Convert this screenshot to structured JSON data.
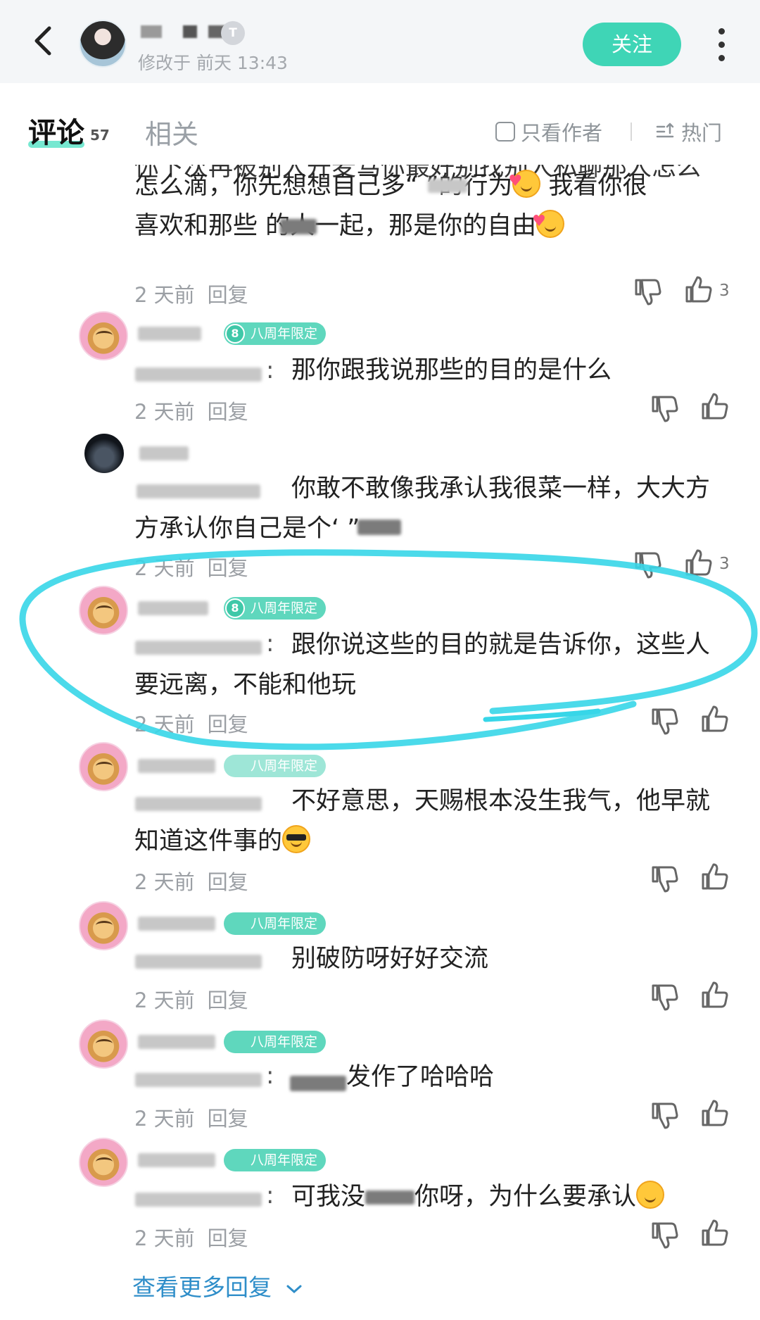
{
  "header": {
    "modified": "修改于 前天 13:43",
    "level_badge": "T",
    "follow_label": "关注"
  },
  "tabs": {
    "comments_label": "评论",
    "comments_count": "57",
    "related_label": "相关",
    "author_only_label": "只看作者",
    "sort_label": "热门"
  },
  "comments": [
    {
      "cut_line": "你下次再被别人开麦骂你最好别找别人私聊那人怎么",
      "lines": [
        "怎么滴，你先想想自己多“      ”的行为",
        "   我看你很",
        "喜欢和那些        的人一起，那是你的自由"
      ],
      "time": "2 天前",
      "reply": "回复",
      "likes": "3"
    },
    {
      "badge": "八周年限定",
      "badge_num": "8",
      "text": "那你跟我说那些的目的是什么",
      "time": "2 天前",
      "reply": "回复"
    },
    {
      "line1": "你敢不敢像我承认我很菜一样，大大方",
      "line2": "方承认你自己是个‘       ”",
      "time": "2 天前",
      "reply": "回复",
      "likes": "3"
    },
    {
      "badge": "八周年限定",
      "badge_num": "8",
      "line1": "跟你说这些的目的就是告诉你，这些人",
      "line2": "要远离，不能和他玩",
      "time": "2 天前",
      "reply": "回复"
    },
    {
      "badge": "八周年限定",
      "line1": "不好意思，天赐根本没生我气，他早就",
      "line2": "知道这件事的",
      "time": "2 天前",
      "reply": "回复"
    },
    {
      "badge": "八周年限定",
      "text": "别破防呀好好交流",
      "time": "2 天前",
      "reply": "回复"
    },
    {
      "badge": "八周年限定",
      "text": "发作了哈哈哈",
      "time": "2 天前",
      "reply": "回复"
    },
    {
      "badge": "八周年限定",
      "text_a": "可我没",
      "text_b": "你呀，为什么要承认",
      "time": "2 天前",
      "reply": "回复"
    }
  ],
  "see_more": "查看更多回复",
  "colors": {
    "accent": "#3fd5b6",
    "badge": "#5fd7bd",
    "link": "#2f8ec9",
    "annotation": "#37d6e8"
  },
  "icons": [
    "back-arrow-icon",
    "more-dots-icon",
    "sort-hot-icon",
    "thumb-down-icon",
    "thumb-up-icon",
    "chevron-down-icon"
  ]
}
